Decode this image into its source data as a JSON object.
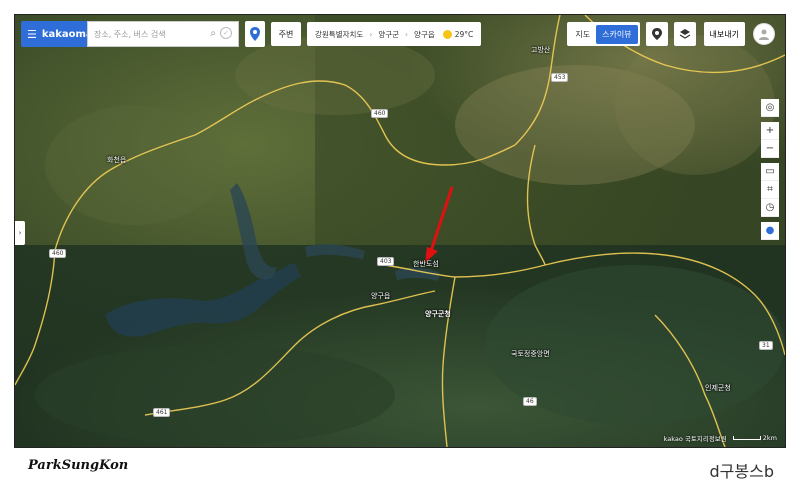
{
  "app": {
    "logo_text": "kakaomap"
  },
  "search": {
    "placeholder": "장소, 주소, 버스 검색"
  },
  "toolbar": {
    "near_label": "주변"
  },
  "breadcrumb": {
    "items": [
      "강원특별자치도",
      "양구군",
      "양구읍"
    ],
    "temperature": "29°C"
  },
  "map_type": {
    "options": [
      "지도",
      "스카이뷰"
    ],
    "selected": "스카이뷰"
  },
  "export_label": "내보내기",
  "map_labels": {
    "place_1": "한반도섬",
    "place_2": "양구읍",
    "place_3": "양구군청",
    "place_4": "국토정중앙면",
    "place_5": "인제군청",
    "place_6": "화천읍",
    "place_7": "고방산",
    "road_460": "460",
    "road_453": "453",
    "road_403": "403",
    "road_461": "461",
    "road_46": "46",
    "road_31": "31"
  },
  "copyright": "kakao 국토지리정보원",
  "scale_label": "2km",
  "watermark_left": "ParkSungKon",
  "watermark_right": "d구봉스b",
  "colors": {
    "accent": "#2f6ed8",
    "arrow": "#e01010",
    "road": "#f2cf55"
  },
  "icons": [
    "menu-icon",
    "search-icon",
    "clear-icon",
    "location-pin-icon",
    "sun-icon",
    "pin-icon",
    "layers-icon",
    "profile-icon",
    "current-location-icon",
    "zoom-in-icon",
    "zoom-out-icon",
    "ruler-icon",
    "area-icon",
    "compass-icon",
    "marker-icon",
    "chevron-right-icon"
  ]
}
